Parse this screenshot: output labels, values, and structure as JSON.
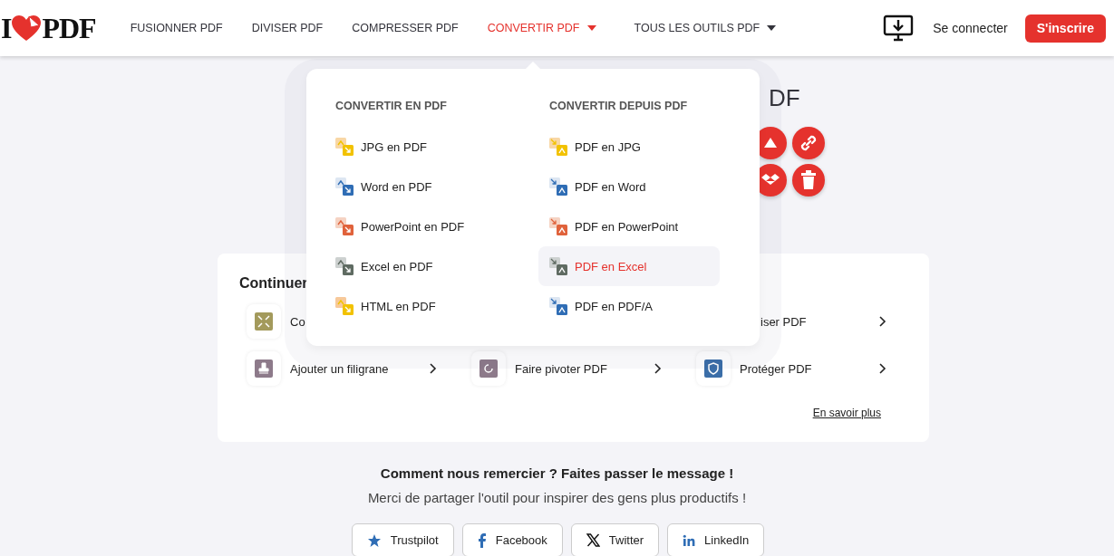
{
  "header": {
    "logo": {
      "left": "I",
      "right": "PDF"
    },
    "nav": [
      {
        "label": "FUSIONNER PDF",
        "selected": false,
        "dropdown": false
      },
      {
        "label": "DIVISER PDF",
        "selected": false,
        "dropdown": false
      },
      {
        "label": "COMPRESSER PDF",
        "selected": false,
        "dropdown": false
      },
      {
        "label": "CONVERTIR PDF",
        "selected": true,
        "dropdown": true
      },
      {
        "label": "TOUS LES OUTILS PDF",
        "selected": false,
        "dropdown": true
      }
    ],
    "login": "Se connecter",
    "signup": "S'inscrire"
  },
  "tool_panel": {
    "title": "DF",
    "actions": [
      {
        "kind": "cloud"
      },
      {
        "kind": "link"
      },
      {
        "kind": "dropbox"
      },
      {
        "kind": "trash"
      }
    ]
  },
  "continue_section": {
    "title": "Continuer",
    "tools": [
      {
        "label": "Co",
        "kind": "compress",
        "arrow": false
      },
      {
        "label": "iser PDF",
        "arrow": true
      },
      {
        "label": "Ajouter un filigrane",
        "kind": "stamp",
        "arrow": true
      },
      {
        "label": "Faire pivoter PDF",
        "kind": "rotate",
        "arrow": true
      },
      {
        "label": "Protéger PDF",
        "kind": "shield",
        "arrow": true
      }
    ],
    "learn_more": "En savoir plus"
  },
  "share": {
    "title": "Comment nous remercier ? Faites passer le message !",
    "text": "Merci de partager l'outil pour inspirer des gens plus productifs !",
    "buttons": [
      {
        "label": "Trustpilot",
        "kind": "star"
      },
      {
        "label": "Facebook",
        "kind": "facebook"
      },
      {
        "label": "Twitter",
        "kind": "x"
      },
      {
        "label": "LinkedIn",
        "kind": "linkedin"
      }
    ]
  },
  "convert_menu": {
    "columns": [
      {
        "heading": "CONVERTIR EN PDF",
        "items": [
          {
            "label": "JPG en PDF",
            "kind": "jpg",
            "selected": false
          },
          {
            "label": "Word en PDF",
            "kind": "word",
            "selected": false
          },
          {
            "label": "PowerPoint en PDF",
            "kind": "ppt",
            "selected": false
          },
          {
            "label": "Excel en PDF",
            "kind": "excel",
            "selected": false
          },
          {
            "label": "HTML en PDF",
            "kind": "html",
            "selected": false
          }
        ]
      },
      {
        "heading": "CONVERTIR DEPUIS PDF",
        "items": [
          {
            "label": "PDF en JPG",
            "kind": "jpg",
            "selected": false
          },
          {
            "label": "PDF en Word",
            "kind": "word",
            "selected": false
          },
          {
            "label": "PDF en PowerPoint",
            "kind": "ppt",
            "selected": false
          },
          {
            "label": "PDF en Excel",
            "kind": "excel",
            "selected": true
          },
          {
            "label": "PDF en PDF/A",
            "kind": "pdfa",
            "selected": false
          }
        ]
      }
    ]
  }
}
